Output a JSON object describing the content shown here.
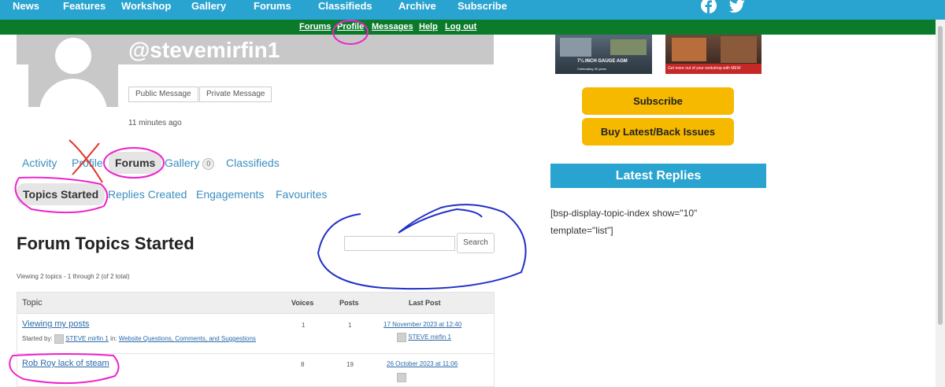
{
  "topnav": {
    "items": [
      "News",
      "Features",
      "Workshop",
      "Gallery",
      "Forums",
      "Classifieds",
      "Archive",
      "Subscribe"
    ],
    "social": {
      "facebook": "f"
    }
  },
  "subnav": {
    "items": [
      "Forums",
      "Profile",
      "Messages",
      "Help",
      "Log out"
    ]
  },
  "profile": {
    "username": "@stevemirfin1",
    "public_message": "Public Message",
    "private_message": "Private Message",
    "last_active": "11 minutes ago"
  },
  "tabs": {
    "primary": [
      "Activity",
      "Profile",
      "Forums",
      "Gallery",
      "Classifieds"
    ],
    "gallery_count": "0",
    "secondary": [
      "Topics Started",
      "Replies Created",
      "Engagements",
      "Favourites"
    ]
  },
  "content": {
    "heading": "Forum Topics Started",
    "search_button": "Search",
    "search_value": "",
    "count_text": "Viewing 2 topics - 1 through 2 (of 2 total)"
  },
  "table": {
    "headers": {
      "topic": "Topic",
      "voices": "Voices",
      "posts": "Posts",
      "last_post": "Last Post"
    },
    "rows": [
      {
        "title": "Viewing my posts",
        "started_by_label": "Started by:",
        "author": "STEVE mirfin 1",
        "in_label": "in:",
        "forum": "Website Questions, Comments, and Suggestions",
        "voices": "1",
        "posts": "1",
        "last_post": "17 November 2023 at 12:40",
        "last_author": "STEVE mirfin 1"
      },
      {
        "title": "Rob Roy lack of steam",
        "voices": "8",
        "posts": "19",
        "last_post": "26 October 2023 at 11:06"
      }
    ]
  },
  "sidebar": {
    "ad1_caption": "7¼ INCH GAUGE AGM",
    "ad1_sub": "Celebrating 30 years",
    "ad2_caption": "Get more out of your workshop with MEW",
    "subscribe": "Subscribe",
    "issues": "Buy Latest/Back Issues",
    "latest_replies": "Latest Replies",
    "shortcode": "[bsp-display-topic-index show=\"10\" template=\"list\"]"
  },
  "colors": {
    "nav_blue": "#29a3cf",
    "subnav_green": "#0b7a2a",
    "button_yellow": "#f6b900",
    "link_blue": "#2b6aa8",
    "annotation_magenta": "#ee22cc",
    "annotation_red": "#e0352b",
    "annotation_blue": "#2230c8"
  },
  "icons": [
    "facebook-icon",
    "twitter-icon",
    "avatar-placeholder-icon"
  ]
}
